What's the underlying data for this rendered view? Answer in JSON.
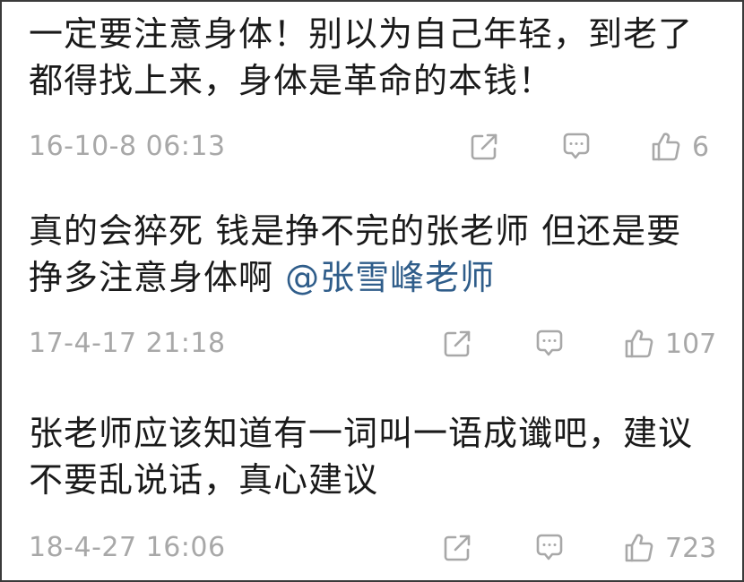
{
  "comments": [
    {
      "lines": [
        "一定要注意身体！别以为自己年轻，到老了",
        "都得找上来，身体是革命的本钱！"
      ],
      "mention": "",
      "timestamp": "16-10-8 06:13",
      "likes": "6"
    },
    {
      "lines": [
        "真的会猝死  钱是挣不完的张老师 但还是要",
        "挣多注意身体啊 "
      ],
      "mention": "@张雪峰老师",
      "timestamp": "17-4-17 21:18",
      "likes": "107"
    },
    {
      "lines": [
        "张老师应该知道有一词叫一语成谶吧，建议",
        "不要乱说话，真心建议"
      ],
      "mention": "",
      "timestamp": "18-4-27 16:06",
      "likes": "723"
    }
  ],
  "icons": {
    "share": "share-icon",
    "comment": "comment-icon",
    "like": "thumbs-up-icon"
  },
  "colors": {
    "text": "#1a1a1a",
    "meta": "#a8a8a8",
    "mention": "#2f5d8a",
    "border": "#3a3a3a"
  }
}
